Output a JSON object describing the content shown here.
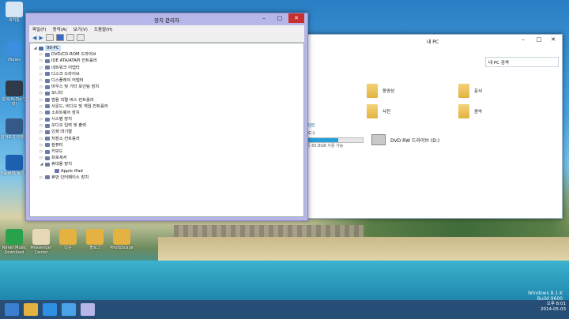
{
  "device_manager": {
    "title": "장치 관리자",
    "menu": [
      "파일(F)",
      "동작(A)",
      "보기(V)",
      "도움말(H)"
    ],
    "root": "99-PC",
    "nodes": [
      "DVD/CD-ROM 드라이브",
      "IDE ATA/ATAPI 컨트롤러",
      "네트워크 어댑터",
      "디스크 드라이브",
      "디스플레이 어댑터",
      "마우스 및 기타 포인팅 장치",
      "모니터",
      "범용 직렬 버스 컨트롤러",
      "사운드, 비디오 및 게임 컨트롤러",
      "소프트웨어 장치",
      "시스템 장치",
      "오디오 입력 및 출력",
      "인쇄 대기열",
      "저장소 컨트롤러",
      "컴퓨터",
      "키보드",
      "프로세서",
      "휴대용 장치",
      "Apple iPad",
      "휴먼 인터페이스 장치"
    ]
  },
  "explorer": {
    "title": "내 PC",
    "search_placeholder": "내 PC 검색",
    "folders": [
      "동영상",
      "문서",
      "사진",
      "음악"
    ],
    "section_label": "이트",
    "drive_c_label": "(C:)",
    "drive_c_usage": "중 65.8GB 사용 가능",
    "dvd_label": "DVD RW 드라이브 (D:)",
    "drive_c_used_fraction": 0.55
  },
  "desktop_icons": [
    "휴지통",
    "iTunes",
    "알씨(ALZip 반려)",
    "알아보기 이벤트",
    "EaseUS 동의서",
    "Naver Music Download",
    "Messenger Center",
    "다운",
    "블로그",
    "PhotoScape"
  ],
  "watermark": {
    "line1": "Windows 8.1 K",
    "line2": "Build 9600"
  },
  "clock": {
    "time": "오후 8:01",
    "date": "2014-05-03"
  }
}
